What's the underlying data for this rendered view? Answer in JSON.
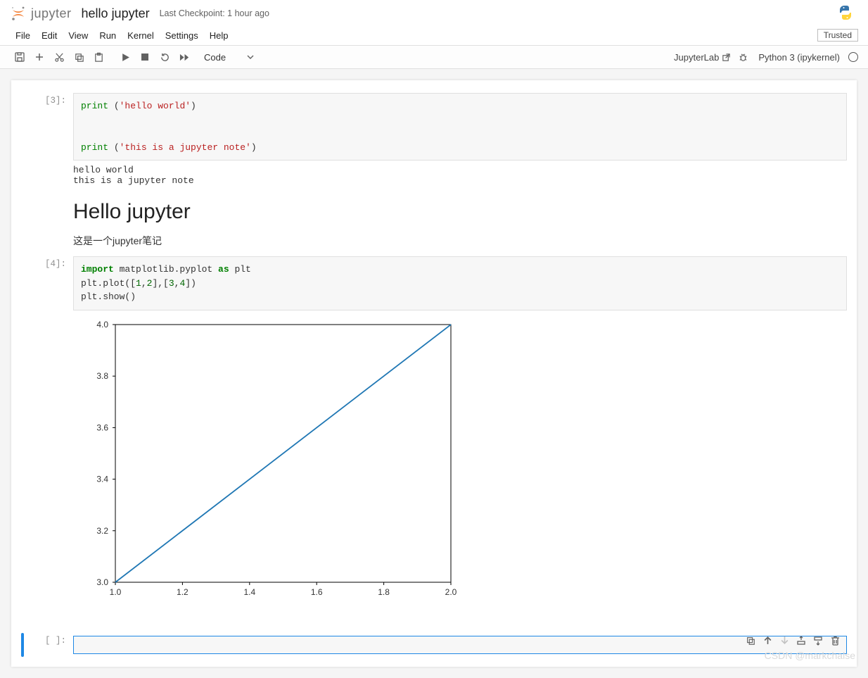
{
  "header": {
    "logo_text": "jupyter",
    "notebook_title": "hello jupyter",
    "checkpoint": "Last Checkpoint: 1 hour ago"
  },
  "menu": {
    "items": [
      "File",
      "Edit",
      "View",
      "Run",
      "Kernel",
      "Settings",
      "Help"
    ],
    "trusted": "Trusted"
  },
  "toolbar": {
    "celltype": "Code",
    "jupyterlab_link": "JupyterLab",
    "kernel_name": "Python 3 (ipykernel)"
  },
  "cells": [
    {
      "kind": "code",
      "prompt": "[3]:",
      "code_lines": [
        [
          {
            "c": "tok-builtin",
            "t": "print"
          },
          {
            "c": "",
            "t": " ("
          },
          {
            "c": "tok-str",
            "t": "'hello world'"
          },
          {
            "c": "",
            "t": ")"
          }
        ],
        [],
        [],
        [
          {
            "c": "tok-builtin",
            "t": "print"
          },
          {
            "c": "",
            "t": " ("
          },
          {
            "c": "tok-str",
            "t": "'this is a jupyter note'"
          },
          {
            "c": "",
            "t": ")"
          }
        ]
      ],
      "output": "hello world\nthis is a jupyter note"
    },
    {
      "kind": "markdown",
      "heading": "Hello jupyter",
      "paragraph": "这是一个jupyter笔记"
    },
    {
      "kind": "code",
      "prompt": "[4]:",
      "code_lines": [
        [
          {
            "c": "tok-kw",
            "t": "import"
          },
          {
            "c": "",
            "t": " matplotlib.pyplot "
          },
          {
            "c": "tok-kw",
            "t": "as"
          },
          {
            "c": "",
            "t": " plt"
          }
        ],
        [
          {
            "c": "",
            "t": "plt.plot(["
          },
          {
            "c": "tok-num",
            "t": "1"
          },
          {
            "c": "",
            "t": ","
          },
          {
            "c": "tok-num",
            "t": "2"
          },
          {
            "c": "",
            "t": "],["
          },
          {
            "c": "tok-num",
            "t": "3"
          },
          {
            "c": "",
            "t": ","
          },
          {
            "c": "tok-num",
            "t": "4"
          },
          {
            "c": "",
            "t": "])"
          }
        ],
        [
          {
            "c": "",
            "t": "plt.show()"
          }
        ]
      ],
      "has_chart": true
    },
    {
      "kind": "empty",
      "prompt": "[ ]:"
    }
  ],
  "chart_data": {
    "type": "line",
    "x": [
      1,
      2
    ],
    "y": [
      3,
      4
    ],
    "xlim": [
      1.0,
      2.0
    ],
    "ylim": [
      3.0,
      4.0
    ],
    "xticks": [
      1.0,
      1.2,
      1.4,
      1.6,
      1.8,
      2.0
    ],
    "yticks": [
      3.0,
      3.2,
      3.4,
      3.6,
      3.8,
      4.0
    ],
    "line_color": "#1f77b4",
    "title": "",
    "xlabel": "",
    "ylabel": ""
  },
  "watermark": "CSDN @markchalse"
}
